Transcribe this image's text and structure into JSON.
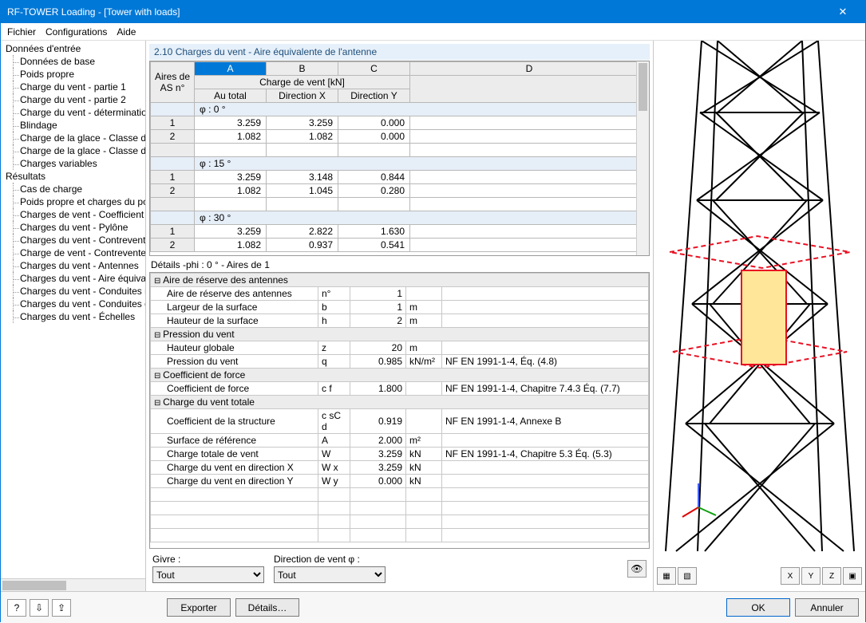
{
  "window": {
    "title": "RF-TOWER Loading - [Tower with loads]"
  },
  "menu": {
    "file": "Fichier",
    "config": "Configurations",
    "help": "Aide"
  },
  "tree": {
    "input_root": "Données d'entrée",
    "input_items": [
      "Données de base",
      "Poids propre",
      "Charge du vent - partie 1",
      "Charge du vent - partie 2",
      "Charge du vent - détermination",
      "Blindage",
      "Charge de la glace - Classe de",
      "Charge de la glace - Classe de",
      "Charges variables"
    ],
    "results_root": "Résultats",
    "results_items": [
      "Cas de charge",
      "Poids propre et charges du poid",
      "Charges de vent - Coefficient d",
      "Charges du vent - Pylône",
      "Charges du vent - Contrevente",
      "Charge de vent - Contreventer",
      "Charges du vent - Antennes",
      "Charges du vent - Aire équivale",
      "Charges du vent - Conduites in",
      "Charges du vent - Conduites de",
      "Charges du vent - Échelles"
    ]
  },
  "panel_title": "2.10 Charges du vent - Aire équivalente de l'antenne",
  "cols": {
    "as": "Aires de AS n°",
    "wind_header": "Charge de vent [kN]",
    "A": "Au total",
    "B": "Direction X",
    "C": "Direction Y",
    "letters": [
      "A",
      "B",
      "C",
      "D"
    ]
  },
  "groups": [
    {
      "label": "φ : 0 °",
      "rows": [
        {
          "n": "1",
          "a": "3.259",
          "b": "3.259",
          "c": "0.000"
        },
        {
          "n": "2",
          "a": "1.082",
          "b": "1.082",
          "c": "0.000"
        }
      ]
    },
    {
      "label": "φ : 15 °",
      "rows": [
        {
          "n": "1",
          "a": "3.259",
          "b": "3.148",
          "c": "0.844"
        },
        {
          "n": "2",
          "a": "1.082",
          "b": "1.045",
          "c": "0.280"
        }
      ]
    },
    {
      "label": "φ : 30 °",
      "rows": [
        {
          "n": "1",
          "a": "3.259",
          "b": "2.822",
          "c": "1.630"
        },
        {
          "n": "2",
          "a": "1.082",
          "b": "0.937",
          "c": "0.541"
        }
      ]
    }
  ],
  "details_title": "Détails -phi : 0 ° - Aires de 1",
  "details": {
    "s1": "Aire de réserve des antennes",
    "r1": {
      "l": "Aire de réserve des antennes",
      "s": "n°",
      "v": "1",
      "u": ""
    },
    "r2": {
      "l": "Largeur de la surface",
      "s": "b",
      "v": "1",
      "u": "m"
    },
    "r3": {
      "l": "Hauteur de la surface",
      "s": "h",
      "v": "2",
      "u": "m"
    },
    "s2": "Pression du vent",
    "r4": {
      "l": "Hauteur globale",
      "s": "z",
      "v": "20",
      "u": "m"
    },
    "r5": {
      "l": "Pression du vent",
      "s": "q",
      "v": "0.985",
      "u": "kN/m²",
      "ref": "NF EN 1991-1-4, Éq. (4.8)"
    },
    "s3": "Coefficient de force",
    "r6": {
      "l": "Coefficient de force",
      "s": "c f",
      "v": "1.800",
      "u": "",
      "ref": "NF EN 1991-1-4, Chapitre 7.4.3 Éq. (7.7)"
    },
    "s4": "Charge du vent totale",
    "r7": {
      "l": "Coefficient de la structure",
      "s": "c sC d",
      "v": "0.919",
      "u": "",
      "ref": "NF EN 1991-1-4, Annexe B"
    },
    "r8": {
      "l": "Surface de référence",
      "s": "A",
      "v": "2.000",
      "u": "m²"
    },
    "r9": {
      "l": "Charge totale de vent",
      "s": "W",
      "v": "3.259",
      "u": "kN",
      "ref": "NF EN 1991-1-4, Chapitre 5.3 Éq. (5.3)"
    },
    "r10": {
      "l": "Charge du vent en direction X",
      "s": "W x",
      "v": "3.259",
      "u": "kN"
    },
    "r11": {
      "l": "Charge du vent en direction Y",
      "s": "W y",
      "v": "0.000",
      "u": "kN"
    }
  },
  "controls": {
    "givre_label": "Givre :",
    "givre_value": "Tout",
    "dir_label": "Direction de vent φ :",
    "dir_value": "Tout"
  },
  "footer": {
    "exporter": "Exporter",
    "details": "Détails…",
    "ok": "OK",
    "cancel": "Annuler"
  }
}
